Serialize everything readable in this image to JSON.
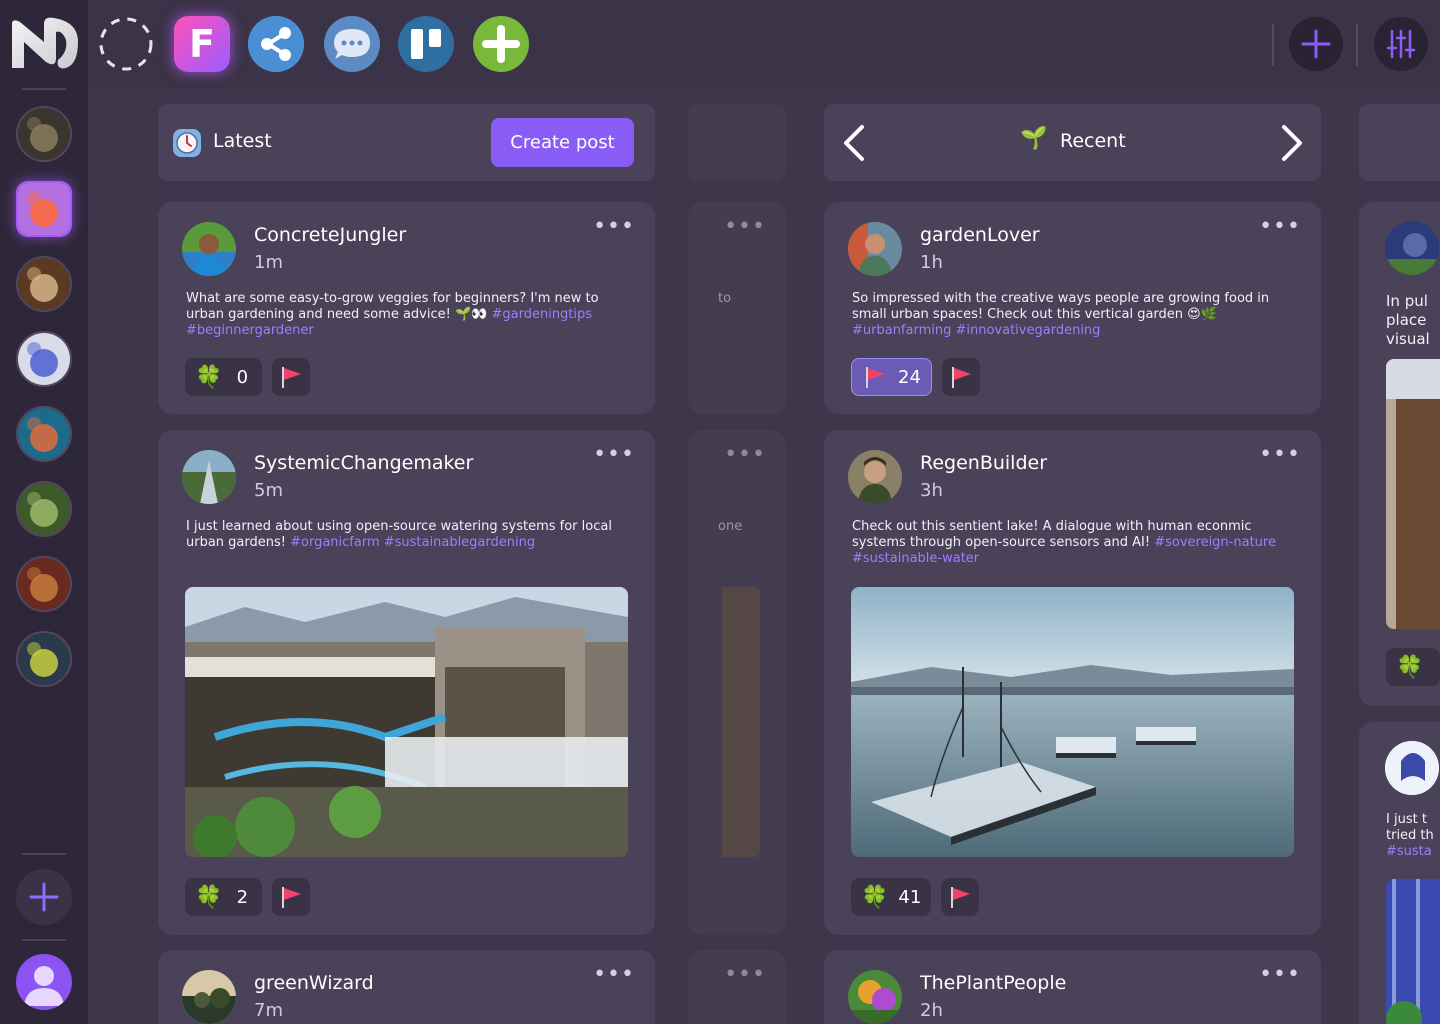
{
  "sidebar": {
    "spaces": [
      {
        "name": "space-avatar-1",
        "active": false,
        "c1": "#3b3530",
        "c2": "#8a7a5a"
      },
      {
        "name": "space-avatar-2",
        "active": true,
        "c1": "#b46fe0",
        "c2": "#ff6a3a"
      },
      {
        "name": "space-avatar-3",
        "active": false,
        "c1": "#5a3a20",
        "c2": "#d8b48a"
      },
      {
        "name": "space-avatar-4",
        "active": false,
        "c1": "#d9dce8",
        "c2": "#4a5fd0"
      },
      {
        "name": "space-avatar-5",
        "active": false,
        "c1": "#1d6a8a",
        "c2": "#e06a3a"
      },
      {
        "name": "space-avatar-6",
        "active": false,
        "c1": "#3f5a2a",
        "c2": "#9ab86a"
      },
      {
        "name": "space-avatar-7",
        "active": false,
        "c1": "#6a2a20",
        "c2": "#c67a3a"
      },
      {
        "name": "space-avatar-8",
        "active": false,
        "c1": "#2a3a4a",
        "c2": "#c8d040"
      }
    ],
    "add_label": "+"
  },
  "topbar": {
    "apps": [
      {
        "name": "loading-placeholder-icon",
        "type": "dashed"
      },
      {
        "name": "feed-app-icon",
        "type": "letter",
        "letter": "F"
      },
      {
        "name": "share-app-icon",
        "type": "share"
      },
      {
        "name": "chat-app-icon",
        "type": "chat"
      },
      {
        "name": "board-app-icon",
        "type": "board"
      },
      {
        "name": "add-app-icon",
        "type": "plus"
      }
    ]
  },
  "columns": {
    "left": {
      "header_title": "Latest",
      "create_post_label": "Create post",
      "posts": [
        {
          "username": "ConcreteJungler",
          "time": "1m",
          "text": "What are some easy-to-grow veggies for beginners? I'm new to urban gardening and need some advice! 🌱👀 ",
          "tags": "#gardeningtips #beginnergardener",
          "reaction_emoji": "🍀",
          "reaction_count": "0"
        },
        {
          "username": "SystemicChangemaker",
          "time": "5m",
          "text": "I just learned about using open-source watering systems for local urban gardens! ",
          "tags": "#organicfarm #sustainablegardening",
          "reaction_emoji": "🍀",
          "reaction_count": "2"
        },
        {
          "username": "greenWizard",
          "time": "7m"
        }
      ]
    },
    "center_partial": {
      "snippet_1": "to",
      "snippet_2": "one"
    },
    "right": {
      "header_title": "Recent",
      "header_emoji": "🌱",
      "posts": [
        {
          "username": "gardenLover",
          "time": "1h",
          "text": "So impressed with the creative ways people are growing food in small urban spaces! Check out this vertical garden 😍🌿 ",
          "tags": "#urbanfarming #innovativegardening",
          "reaction_count": "24"
        },
        {
          "username": "RegenBuilder",
          "time": "3h",
          "text": "Check out this sentient lake! A dialogue with human econmic systems through open-source sensors and AI! ",
          "tags": "#sovereign-nature #sustainable-water",
          "reaction_emoji": "🍀",
          "reaction_count": "41"
        },
        {
          "username": "ThePlantPeople",
          "time": "2h"
        }
      ]
    },
    "far_right_partial": {
      "snippet_1_line1": "In pul",
      "snippet_1_line2": "place",
      "snippet_1_line3": "visual",
      "snippet_2_line1": "I just t",
      "snippet_2_line2": "tried th",
      "snippet_2_line3": "#susta",
      "reaction_emoji": "🍀"
    }
  },
  "more_label": "•••",
  "accent": "#8a5cf6",
  "tag_color": "#a37bff"
}
